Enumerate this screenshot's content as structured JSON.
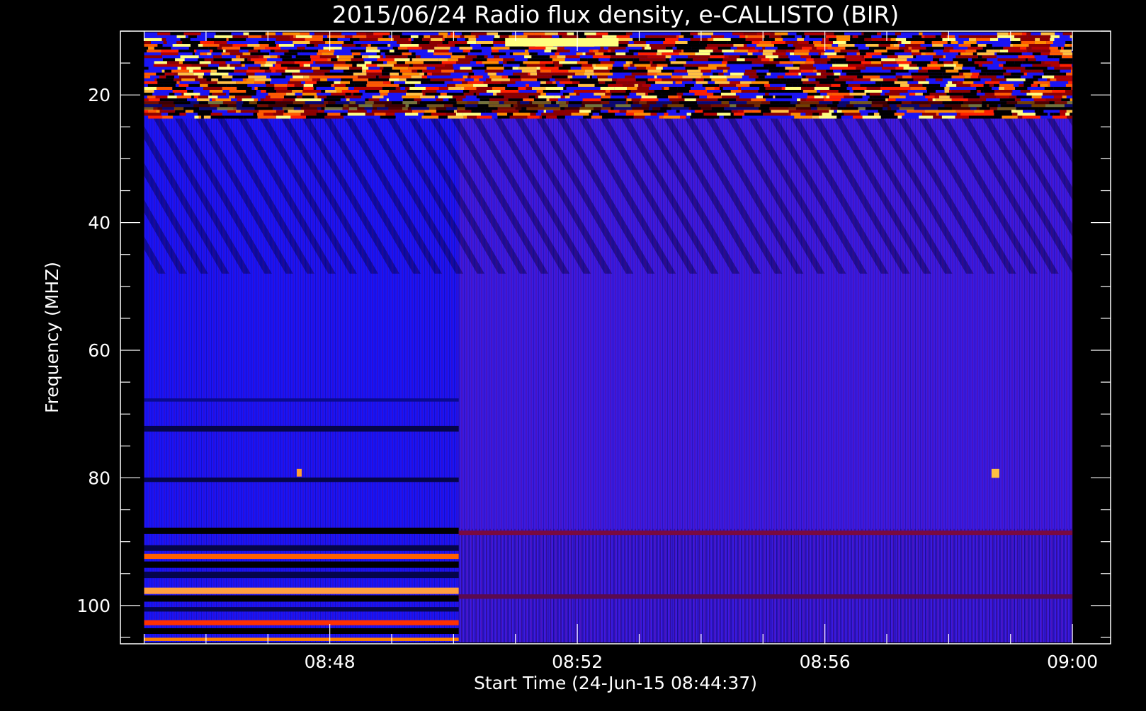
{
  "chart_data": {
    "type": "heatmap",
    "title": "2015/06/24  Radio flux density, e-CALLISTO (BIR)",
    "xlabel": "Start Time (24-Jun-15 08:44:37)",
    "ylabel": "Frequency (MHZ)",
    "x_range_minutes": [
      "08:44:37",
      "09:00:37"
    ],
    "ylim": [
      10,
      106
    ],
    "y_inverted": true,
    "x_ticks": [
      {
        "time": "08:48",
        "label": "08:48"
      },
      {
        "time": "08:52",
        "label": "08:52"
      },
      {
        "time": "08:56",
        "label": "08:56"
      },
      {
        "time": "09:00",
        "label": "09:00"
      }
    ],
    "y_ticks": [
      {
        "value": 20,
        "label": "20"
      },
      {
        "value": 40,
        "label": "40"
      },
      {
        "value": 60,
        "label": "60"
      },
      {
        "value": 80,
        "label": "80"
      },
      {
        "value": 100,
        "label": "100"
      }
    ],
    "data_time_range": [
      "08:45",
      "09:00"
    ],
    "data_freq_range": [
      10.2,
      105.8
    ],
    "instrument_change_time": "08:50:05",
    "colormap": [
      "#000000",
      "#0000ff",
      "#8b0000",
      "#ff2000",
      "#ff8c00",
      "#ffff80"
    ],
    "background_color": "#000000",
    "foreground_color": "#ffffff",
    "grid": false,
    "legend": "none"
  }
}
